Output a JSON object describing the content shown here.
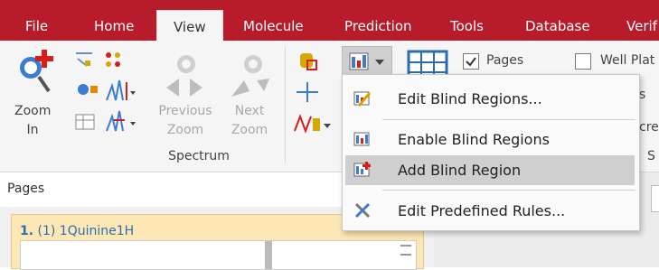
{
  "menu": {
    "tabs": [
      "File",
      "Home",
      "View",
      "Molecule",
      "Prediction",
      "Tools",
      "Database",
      "Verif"
    ]
  },
  "ribbon": {
    "zoom_in_label": "Zoom In",
    "zoom_in_line1": "Zoom",
    "zoom_in_line2": "In",
    "prev_zoom_line1": "Previous",
    "prev_zoom_line2": "Zoom",
    "next_zoom_line1": "Next",
    "next_zoom_line2": "Zoom",
    "group_label": "Spectrum",
    "pages_check_label": "Pages",
    "pages_checked": true,
    "wellplate_label": "Well Plat",
    "wellplate_checked": false,
    "partial_s": "s",
    "partial_cre": "cre",
    "partial_S": "S"
  },
  "dropdown": {
    "items": [
      {
        "label": "Edit Blind Regions...",
        "icon": "edit-blind-regions-icon"
      },
      {
        "label": "Enable Blind Regions",
        "icon": "enable-blind-regions-icon"
      },
      {
        "label": "Add Blind Region",
        "icon": "add-blind-region-icon"
      },
      {
        "label": "Edit Predefined Rules...",
        "icon": "tools-icon"
      }
    ]
  },
  "pages": {
    "header": "Pages",
    "thumb_number": "1.",
    "thumb_title": "(1) 1Quinine1H"
  },
  "colors": {
    "brand": "#b81b2a",
    "accent_blue": "#2c6fb3",
    "hover": "#cfcfcf"
  }
}
